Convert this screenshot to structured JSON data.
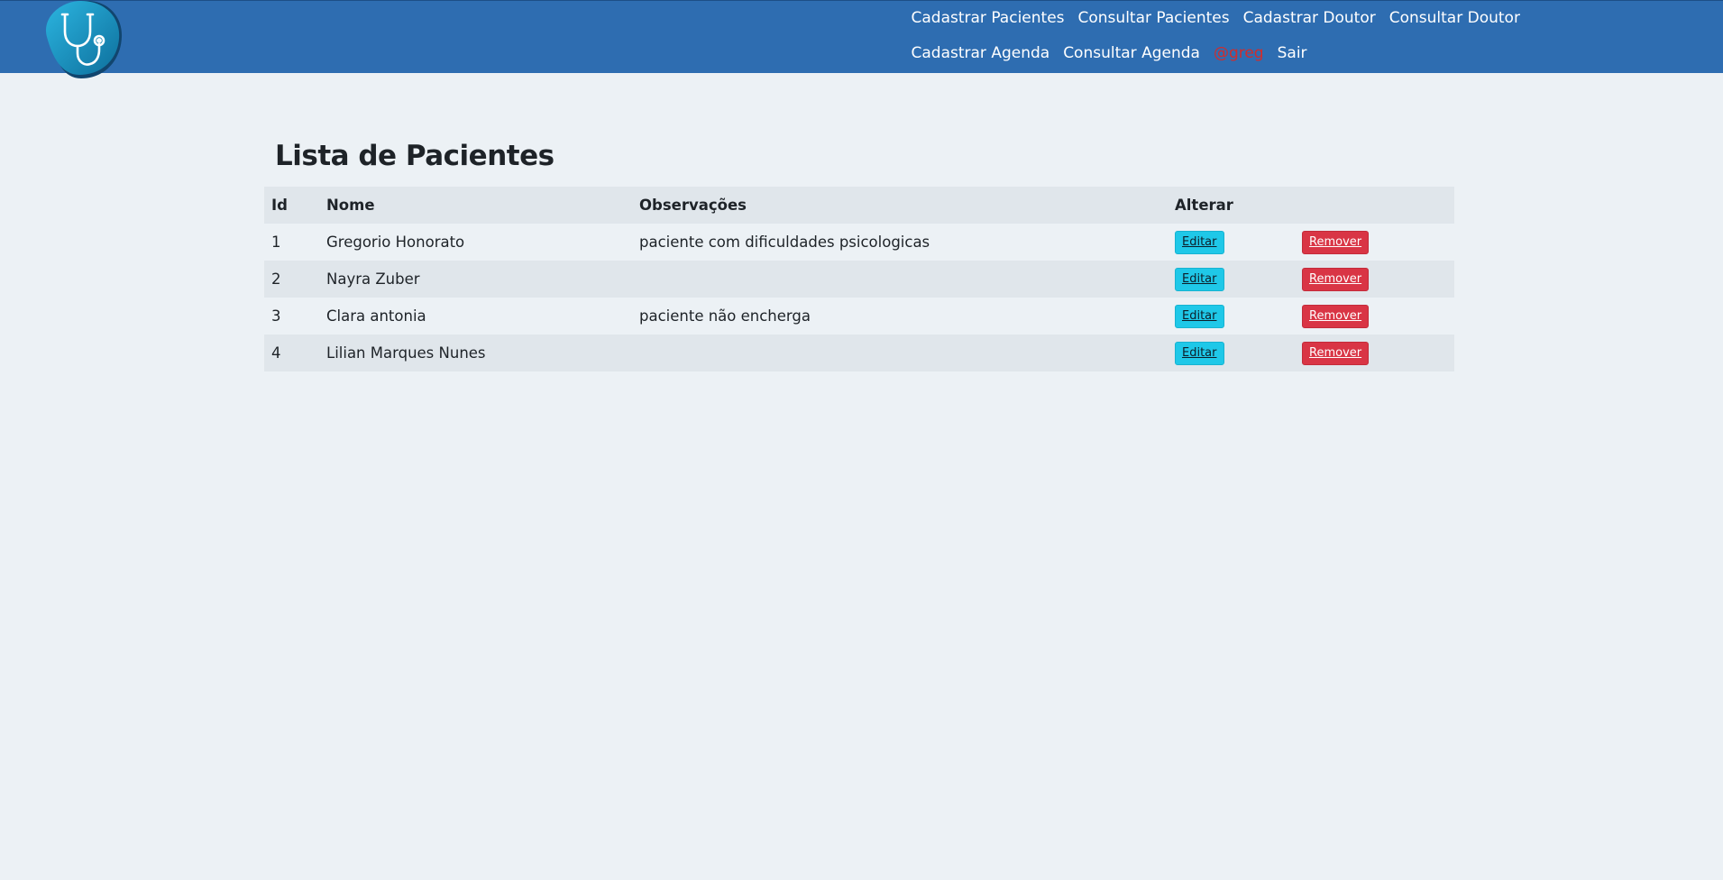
{
  "header": {
    "nav": [
      {
        "label": "Cadastrar Pacientes"
      },
      {
        "label": "Consultar Pacientes"
      },
      {
        "label": "Cadastrar Doutor"
      },
      {
        "label": "Consultar Doutor"
      },
      {
        "label": "Cadastrar Agenda"
      },
      {
        "label": "Consultar Agenda"
      }
    ],
    "user": "@greg",
    "logout": "Sair",
    "logo_icon": "stethoscope-icon"
  },
  "main": {
    "title": "Lista de Pacientes",
    "columns": [
      "Id",
      "Nome",
      "Observações",
      "Alterar"
    ],
    "edit_label": "Editar",
    "remove_label": "Remover",
    "rows": [
      {
        "id": "1",
        "name": "Gregorio Honorato",
        "notes": "paciente com dificuldades psicologicas"
      },
      {
        "id": "2",
        "name": "Nayra Zuber",
        "notes": ""
      },
      {
        "id": "3",
        "name": "Clara antonia",
        "notes": "paciente não encherga"
      },
      {
        "id": "4",
        "name": "Lilian Marques Nunes",
        "notes": ""
      }
    ]
  },
  "colors": {
    "navbar": "#2e6db1",
    "background": "#ecf1f5",
    "edit_button": "#1fc8e8",
    "remove_button": "#d93545",
    "user": "#d12c2c"
  }
}
